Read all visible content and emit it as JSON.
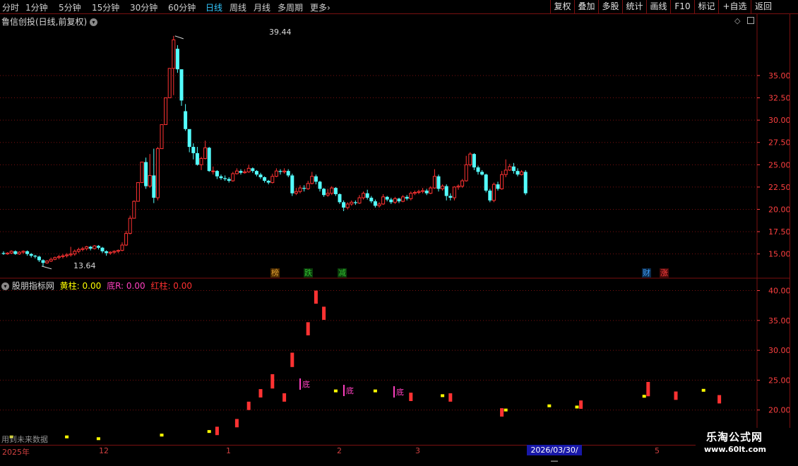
{
  "toolbar": {
    "periods": [
      "分时",
      "1分钟",
      "5分钟",
      "15分钟",
      "30分钟",
      "60分钟",
      "日线",
      "周线",
      "月线",
      "多周期",
      "更多"
    ],
    "active_period": "日线",
    "more_icon": "chevron-right-icon",
    "actions": [
      "复权",
      "叠加",
      "多股",
      "统计",
      "画线",
      "F10",
      "标记",
      "+自选",
      "返回"
    ]
  },
  "main_panel": {
    "title": "鲁信创投(日线,前复权)",
    "dropdown_icon": "chevron-down-icon",
    "corner_icons": [
      "diamond-icon",
      "window-icon"
    ],
    "high_label": "39.44",
    "low_label": "13.64",
    "markers": [
      {
        "text": "榜",
        "color": "#e0a030"
      },
      {
        "text": "跌",
        "color": "#30c030"
      },
      {
        "text": "减",
        "color": "#30c030"
      },
      {
        "text": "财",
        "color": "#40a0ff"
      },
      {
        "text": "涨",
        "color": "#ff4040"
      }
    ]
  },
  "sub_panel": {
    "title": "股朋指标网",
    "dropdown_icon": "chevron-down-icon",
    "legend": [
      {
        "label": "黄柱: 0.00",
        "color": "#ffff00"
      },
      {
        "label": "底R: 0.00",
        "color": "#ff40c0"
      },
      {
        "label": "红柱: 0.00",
        "color": "#ff3030"
      }
    ],
    "bottom_marks": [
      "底",
      "底",
      "底"
    ],
    "future_note": "用到未来数据"
  },
  "time_axis": {
    "labels": [
      "2025年",
      "12",
      "1",
      "2",
      "3",
      "5"
    ],
    "cursor_date": "2026/03/30/—"
  },
  "watermark": {
    "name": "乐淘公式网",
    "url": "www.60lt.com"
  },
  "colors": {
    "up": "#ff3232",
    "down": "#54ffff",
    "grid": "#7a1010",
    "axis_text": "#ff4040",
    "yellow": "#ffff00"
  },
  "chart_data": [
    {
      "type": "candlestick",
      "title": "鲁信创投(日线,前复权)",
      "y_ticks": [
        15.0,
        17.5,
        20.0,
        22.5,
        25.0,
        27.5,
        30.0,
        32.5,
        35.0
      ],
      "ylim": [
        12.6,
        40.3
      ],
      "candles": [
        [
          15.1,
          15.0,
          15.3,
          14.9
        ],
        [
          15.0,
          15.1,
          15.2,
          14.9
        ],
        [
          15.1,
          15.3,
          15.4,
          15.0
        ],
        [
          15.3,
          15.0,
          15.4,
          14.9
        ],
        [
          15.0,
          15.2,
          15.3,
          14.9
        ],
        [
          15.2,
          15.3,
          15.4,
          15.0
        ],
        [
          15.3,
          15.0,
          15.4,
          14.8
        ],
        [
          15.0,
          14.8,
          15.1,
          14.6
        ],
        [
          14.8,
          14.7,
          14.9,
          14.5
        ],
        [
          14.7,
          14.3,
          14.8,
          14.1
        ],
        [
          14.3,
          14.0,
          14.4,
          13.64
        ],
        [
          14.0,
          14.2,
          14.3,
          13.9
        ],
        [
          14.2,
          14.4,
          14.6,
          14.1
        ],
        [
          14.4,
          14.6,
          14.7,
          14.3
        ],
        [
          14.6,
          14.7,
          14.9,
          14.4
        ],
        [
          14.7,
          14.8,
          15.0,
          14.5
        ],
        [
          14.8,
          14.9,
          15.1,
          14.6
        ],
        [
          14.9,
          15.0,
          15.8,
          14.7
        ],
        [
          15.0,
          15.3,
          15.5,
          14.8
        ],
        [
          15.3,
          15.5,
          15.7,
          15.1
        ],
        [
          15.5,
          15.6,
          15.8,
          15.3
        ],
        [
          15.6,
          15.8,
          15.9,
          15.4
        ],
        [
          15.8,
          15.6,
          15.9,
          15.4
        ],
        [
          15.6,
          15.9,
          16.0,
          15.5
        ],
        [
          15.9,
          15.7,
          16.0,
          15.5
        ],
        [
          15.7,
          15.3,
          15.8,
          15.1
        ],
        [
          15.3,
          15.1,
          15.4,
          14.8
        ],
        [
          15.1,
          15.2,
          15.3,
          14.9
        ],
        [
          15.2,
          15.3,
          15.4,
          15.0
        ],
        [
          15.3,
          15.4,
          15.5,
          15.1
        ],
        [
          15.4,
          16.0,
          16.3,
          15.3
        ],
        [
          16.0,
          17.3,
          17.6,
          15.9
        ],
        [
          17.3,
          19.0,
          19.3,
          17.2
        ],
        [
          19.0,
          20.9,
          21.0,
          19.0
        ],
        [
          20.9,
          23.0,
          23.0,
          20.9
        ],
        [
          23.0,
          25.3,
          25.3,
          23.0
        ],
        [
          25.3,
          22.6,
          25.8,
          22.3
        ],
        [
          22.6,
          23.8,
          26.2,
          22.4
        ],
        [
          23.8,
          21.3,
          26.8,
          20.7
        ],
        [
          21.3,
          26.8,
          27.0,
          21.0
        ],
        [
          26.8,
          29.5,
          29.5,
          26.8
        ],
        [
          29.5,
          32.5,
          32.5,
          29.5
        ],
        [
          32.5,
          35.8,
          35.8,
          32.5
        ],
        [
          35.8,
          39.0,
          39.44,
          32.8
        ],
        [
          38.0,
          35.7,
          38.4,
          35.3
        ],
        [
          35.7,
          32.2,
          32.9,
          31.6
        ],
        [
          31.0,
          29.0,
          31.8,
          28.8
        ],
        [
          29.0,
          27.0,
          28.2,
          26.4
        ],
        [
          27.0,
          26.3,
          27.4,
          25.6
        ],
        [
          26.3,
          25.0,
          27.0,
          24.9
        ],
        [
          25.0,
          25.7,
          25.9,
          24.4
        ],
        [
          25.7,
          26.9,
          27.7,
          25.6
        ],
        [
          26.9,
          24.3,
          27.0,
          24.2
        ],
        [
          24.3,
          24.3,
          24.8,
          23.9
        ],
        [
          24.3,
          23.7,
          24.4,
          23.4
        ],
        [
          23.7,
          23.5,
          23.9,
          23.3
        ],
        [
          23.5,
          23.4,
          23.8,
          23.2
        ],
        [
          23.4,
          23.2,
          23.6,
          23.0
        ],
        [
          23.2,
          24.0,
          24.2,
          23.1
        ],
        [
          24.0,
          24.3,
          24.6,
          23.9
        ],
        [
          24.3,
          24.1,
          24.5,
          23.9
        ],
        [
          24.1,
          24.2,
          24.5,
          24.0
        ],
        [
          24.2,
          24.6,
          25.0,
          24.1
        ],
        [
          24.6,
          24.3,
          24.7,
          24.1
        ],
        [
          24.3,
          23.9,
          24.4,
          23.7
        ],
        [
          23.9,
          23.6,
          24.1,
          23.4
        ],
        [
          23.6,
          23.2,
          23.7,
          23.0
        ],
        [
          23.2,
          23.0,
          23.3,
          22.8
        ],
        [
          23.0,
          23.7,
          24.0,
          22.9
        ],
        [
          23.7,
          24.3,
          24.6,
          23.6
        ],
        [
          24.3,
          24.2,
          24.5,
          23.9
        ],
        [
          24.2,
          24.3,
          24.6,
          24.0
        ],
        [
          24.3,
          23.8,
          24.5,
          23.6
        ],
        [
          23.8,
          21.8,
          24.0,
          21.5
        ],
        [
          21.8,
          22.0,
          22.4,
          21.6
        ],
        [
          22.0,
          22.4,
          22.7,
          21.8
        ],
        [
          22.4,
          22.3,
          22.7,
          22.0
        ],
        [
          22.3,
          22.9,
          23.2,
          22.2
        ],
        [
          22.9,
          23.7,
          24.2,
          22.8
        ],
        [
          23.7,
          23.1,
          23.9,
          22.8
        ],
        [
          23.1,
          22.3,
          23.2,
          22.0
        ],
        [
          22.3,
          21.6,
          22.4,
          21.4
        ],
        [
          21.6,
          21.8,
          22.3,
          21.4
        ],
        [
          21.8,
          22.4,
          22.6,
          21.6
        ],
        [
          22.4,
          21.7,
          22.5,
          21.5
        ],
        [
          21.7,
          20.8,
          21.8,
          20.6
        ],
        [
          20.8,
          20.2,
          21.0,
          19.8
        ],
        [
          20.2,
          20.6,
          20.8,
          20.0
        ],
        [
          20.6,
          20.8,
          21.0,
          20.4
        ],
        [
          20.8,
          20.7,
          21.0,
          20.5
        ],
        [
          20.7,
          21.3,
          21.6,
          20.6
        ],
        [
          21.3,
          21.8,
          22.0,
          21.1
        ],
        [
          21.8,
          21.3,
          22.2,
          21.1
        ],
        [
          21.3,
          20.9,
          21.5,
          20.7
        ],
        [
          20.9,
          20.4,
          21.1,
          20.2
        ],
        [
          20.4,
          20.6,
          20.8,
          20.2
        ],
        [
          20.6,
          21.4,
          21.7,
          20.5
        ],
        [
          21.4,
          21.1,
          21.5,
          20.9
        ],
        [
          21.1,
          20.8,
          21.3,
          20.6
        ],
        [
          20.8,
          21.2,
          21.4,
          20.6
        ],
        [
          21.2,
          20.9,
          21.3,
          20.7
        ],
        [
          20.9,
          21.4,
          21.6,
          20.8
        ],
        [
          21.4,
          21.2,
          21.6,
          21.0
        ],
        [
          21.2,
          21.8,
          22.0,
          21.0
        ],
        [
          21.8,
          21.9,
          22.1,
          21.6
        ],
        [
          21.9,
          22.0,
          22.2,
          21.7
        ],
        [
          22.0,
          22.1,
          22.4,
          21.8
        ],
        [
          22.1,
          21.8,
          22.3,
          21.6
        ],
        [
          21.8,
          22.4,
          22.6,
          21.7
        ],
        [
          22.4,
          23.7,
          24.5,
          22.3
        ],
        [
          23.7,
          22.3,
          23.9,
          22.0
        ],
        [
          22.3,
          22.6,
          22.8,
          22.1
        ],
        [
          22.6,
          21.5,
          22.8,
          21.0
        ],
        [
          21.5,
          21.3,
          21.8,
          21.0
        ],
        [
          21.3,
          22.5,
          22.6,
          21.0
        ],
        [
          22.5,
          22.6,
          22.8,
          22.2
        ],
        [
          22.6,
          23.2,
          23.4,
          22.4
        ],
        [
          23.2,
          25.0,
          26.0,
          23.1
        ],
        [
          25.0,
          26.2,
          26.4,
          24.8
        ],
        [
          26.2,
          24.7,
          26.3,
          24.4
        ],
        [
          24.7,
          24.2,
          24.9,
          23.9
        ],
        [
          24.2,
          23.9,
          24.4,
          23.8
        ],
        [
          23.9,
          22.1,
          24.0,
          21.9
        ],
        [
          22.1,
          21.0,
          22.3,
          20.8
        ],
        [
          21.0,
          22.8,
          23.0,
          20.8
        ],
        [
          22.8,
          22.3,
          23.1,
          22.1
        ],
        [
          22.3,
          23.9,
          24.3,
          22.2
        ],
        [
          23.9,
          24.4,
          25.6,
          23.6
        ],
        [
          24.4,
          24.8,
          25.1,
          24.3
        ],
        [
          24.8,
          24.3,
          25.2,
          24.0
        ],
        [
          24.3,
          23.9,
          24.6,
          23.7
        ],
        [
          23.9,
          24.2,
          24.4,
          23.8
        ],
        [
          24.2,
          21.8,
          24.4,
          21.6
        ]
      ]
    },
    {
      "type": "bar",
      "title": "股朋指标网",
      "y_ticks": [
        20.0,
        25.0,
        30.0,
        35.0,
        40.0
      ],
      "ylim": [
        15.0,
        41.6
      ],
      "series": [
        {
          "name": "黄柱",
          "values": [
            [
              2,
              15.5
            ],
            [
              16,
              15.5
            ],
            [
              24,
              15.2
            ],
            [
              40,
              15.8
            ],
            [
              52,
              16.4
            ],
            [
              84,
              23.2
            ],
            [
              94,
              23.2
            ],
            [
              111,
              22.4
            ],
            [
              127,
              20.0
            ],
            [
              138,
              20.7
            ],
            [
              145,
              20.5
            ],
            [
              162,
              22.3
            ],
            [
              177,
              23.3
            ]
          ]
        },
        {
          "name": "红柱",
          "values": [
            [
              54,
              17.2
            ],
            [
              59,
              18.5
            ],
            [
              62,
              21.4
            ],
            [
              65,
              23.5
            ],
            [
              68,
              26.0
            ],
            [
              71,
              22.8
            ],
            [
              73,
              29.6
            ],
            [
              77,
              34.7
            ],
            [
              79,
              40.0
            ],
            [
              81,
              37.3
            ],
            [
              103,
              22.9
            ],
            [
              113,
              22.8
            ],
            [
              126,
              20.3
            ],
            [
              146,
              21.6
            ],
            [
              163,
              24.7
            ],
            [
              170,
              23.1
            ],
            [
              181,
              22.5
            ]
          ]
        }
      ]
    }
  ]
}
